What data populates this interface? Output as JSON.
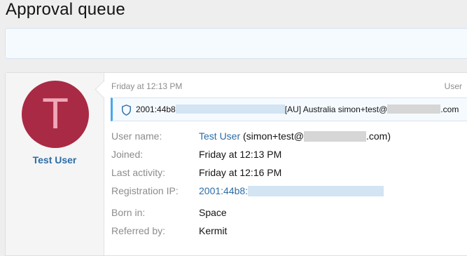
{
  "page": {
    "title": "Approval queue"
  },
  "user": {
    "avatar_letter": "T",
    "name": "Test User"
  },
  "item": {
    "time": "Friday at 12:13 PM",
    "type": "User",
    "ip_prefix": "2001:44b8",
    "ip_geo": "[AU] Australia simon+test@",
    "ip_email_end": ".com"
  },
  "details": {
    "username_label": "User name:",
    "username_value": "Test User",
    "email_prefix": "(simon+test@",
    "email_suffix": ".com)",
    "joined_label": "Joined:",
    "joined_value": "Friday at 12:13 PM",
    "activity_label": "Last activity:",
    "activity_value": "Friday at 12:16 PM",
    "reg_ip_label": "Registration IP:",
    "reg_ip_value": "2001:44b8:",
    "born_label": "Born in:",
    "born_value": "Space",
    "referred_label": "Referred by:",
    "referred_value": "Kermit"
  },
  "colors": {
    "avatar_bg": "#a92a44",
    "link": "#2b6ca6",
    "accent": "#47a7eb"
  }
}
